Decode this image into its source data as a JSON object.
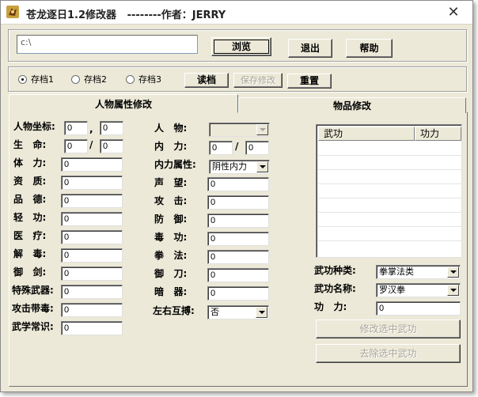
{
  "window": {
    "title": "苍龙逐日1.2修改器   --------作者：JERRY",
    "close_glyph": "✕"
  },
  "toolbar": {
    "path_value": "c:\\",
    "browse_label": "浏览",
    "exit_label": "退出",
    "help_label": "帮助"
  },
  "saves": {
    "slots": [
      {
        "label": "存档1",
        "checked": true
      },
      {
        "label": "存档2",
        "checked": false
      },
      {
        "label": "存档3",
        "checked": false
      }
    ],
    "load_label": "读档",
    "save_label": "保存修改",
    "reset_label": "重置"
  },
  "tabs": {
    "attributes": "人物属性修改",
    "items": "物品修改"
  },
  "attributes": {
    "coords_label": "人物坐标:",
    "coord_x": "0",
    "coord_sep": ",",
    "coord_y": "0",
    "life_label": "生   命:",
    "life_cur": "0",
    "life_sep": "/",
    "life_max": "0",
    "stamina_label": "体   力:",
    "stamina": "0",
    "aptitude_label": "资   质:",
    "aptitude": "0",
    "morality_label": "品   德:",
    "morality": "0",
    "lightness_label": "轻   功:",
    "lightness": "0",
    "medicine_label": "医   疗:",
    "medicine": "0",
    "detox_label": "解   毒:",
    "detox": "0",
    "sword_label": "御   剑:",
    "sword": "0",
    "special_weapon_label": "特殊武器:",
    "special_weapon": "0",
    "poison_attack_label": "攻击带毒:",
    "poison_attack": "0",
    "martial_knowledge_label": "武学常识:",
    "martial_knowledge": "0",
    "character_label": "人   物:",
    "character_value": "",
    "inner_power_label": "内   力:",
    "inner_power_cur": "0",
    "inner_power_sep": "/",
    "inner_power_max": "0",
    "inner_attr_label": "内力属性:",
    "inner_attr_value": "阴性内力",
    "fame_label": "声   望:",
    "fame": "0",
    "attack_label": "攻   击:",
    "attack": "0",
    "defense_label": "防   御:",
    "defense": "0",
    "poison_skill_label": "毒   功:",
    "poison_skill": "0",
    "fist_label": "拳   法:",
    "fist": "0",
    "blade_label": "御   刀:",
    "blade": "0",
    "hidden_weapon_label": "暗   器:",
    "hidden_weapon": "0",
    "dual_wield_label": "左右互搏:",
    "dual_wield_value": "否"
  },
  "martial": {
    "col_name": "武功",
    "col_level": "功力",
    "type_label": "武功种类:",
    "type_value": "拳掌法类",
    "name_label": "武功名称:",
    "name_value": "罗汉拳",
    "power_label": "功   力:",
    "power_value": "0",
    "modify_label": "修改选中武功",
    "remove_label": "去除选中武功"
  }
}
